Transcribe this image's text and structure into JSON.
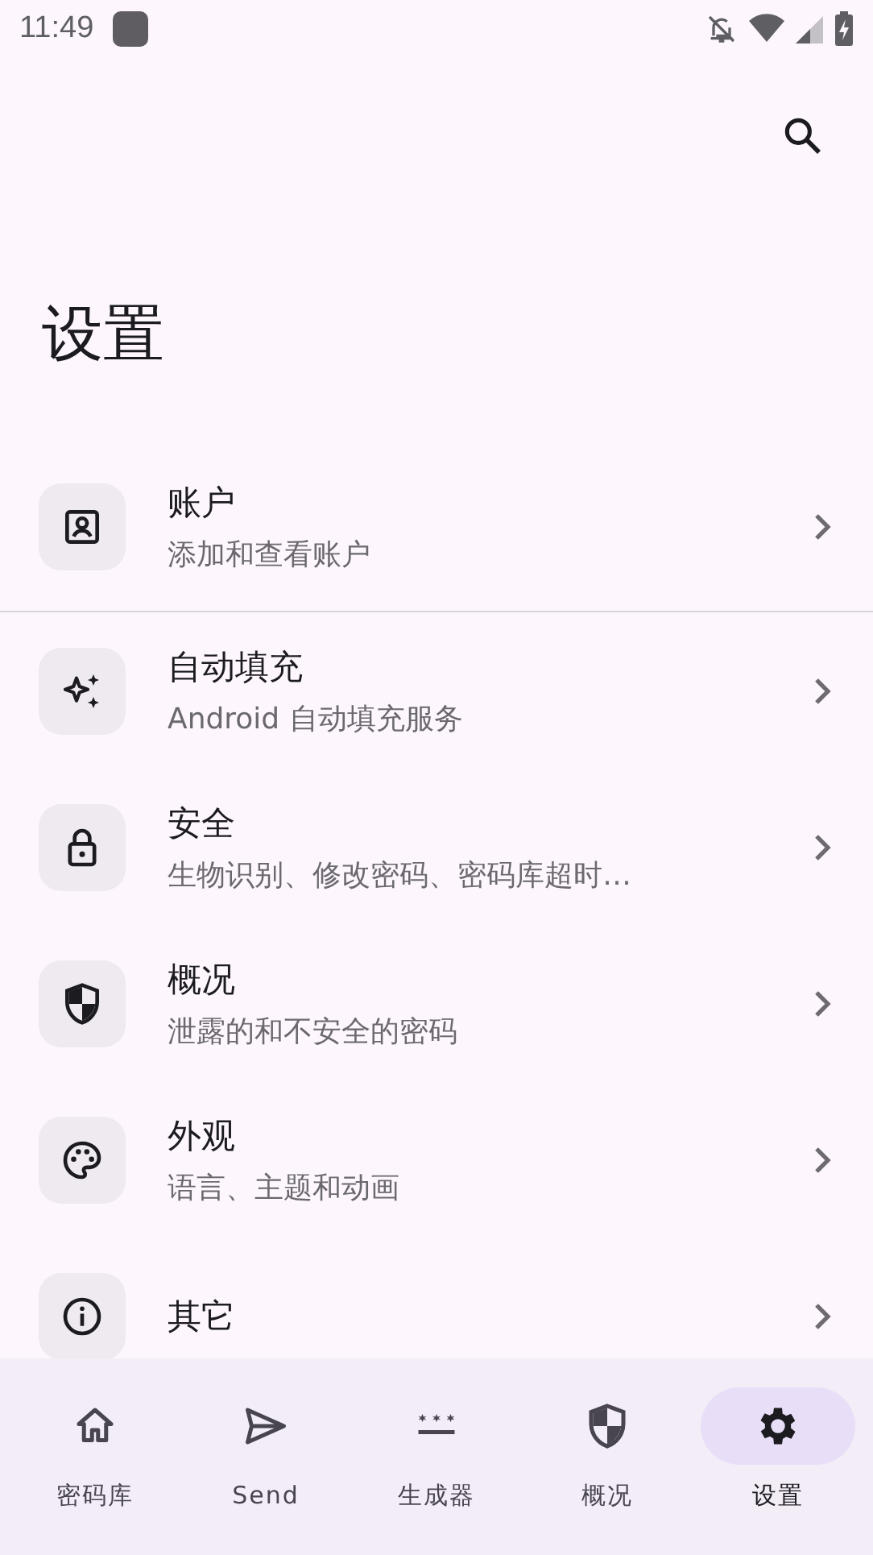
{
  "status_bar": {
    "time": "11:49"
  },
  "title": "设置",
  "items": [
    {
      "kind": "account",
      "title": "账户",
      "subtitle": "添加和查看账户",
      "divider_after": true
    },
    {
      "kind": "autofill",
      "title": "自动填充",
      "subtitle": "Android 自动填充服务",
      "divider_after": false
    },
    {
      "kind": "lock",
      "title": "安全",
      "subtitle": "生物识别、修改密码、密码库超时…",
      "divider_after": false
    },
    {
      "kind": "shield",
      "title": "概况",
      "subtitle": "泄露的和不安全的密码",
      "divider_after": false
    },
    {
      "kind": "palette",
      "title": "外观",
      "subtitle": "语言、主题和动画",
      "divider_after": false
    },
    {
      "kind": "info",
      "title": "其它",
      "divider_after": false
    }
  ],
  "nav": [
    {
      "kind": "home",
      "label": "密码库",
      "selected": false
    },
    {
      "kind": "send",
      "label": "Send",
      "selected": false
    },
    {
      "kind": "generator",
      "label": "生成器",
      "selected": false
    },
    {
      "kind": "shield",
      "label": "概况",
      "selected": false
    },
    {
      "kind": "gear",
      "label": "设置",
      "selected": true
    }
  ]
}
